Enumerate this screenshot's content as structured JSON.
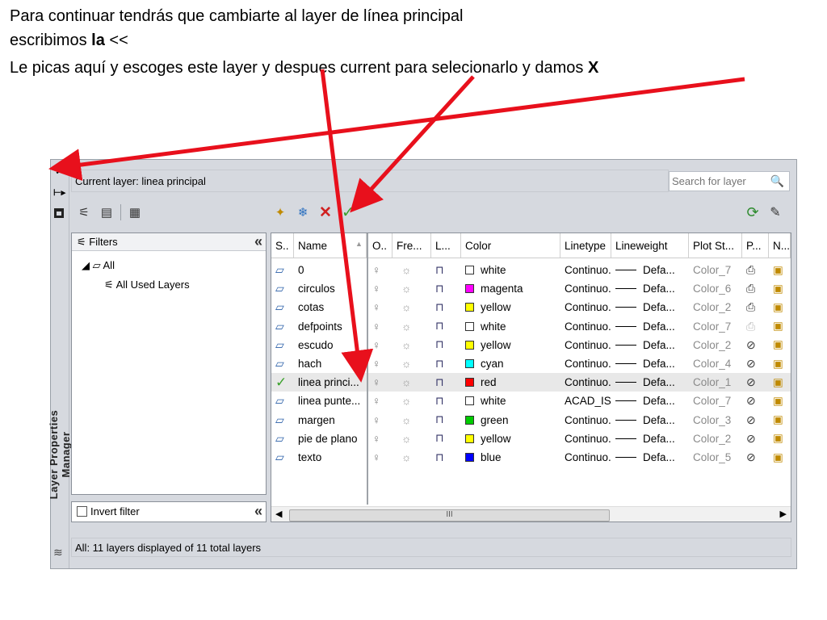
{
  "instructions": {
    "line1": "Para continuar tendrás que cambiarte al layer de línea principal",
    "line2_prefix": "escribimos ",
    "line2_bold": "la",
    "line2_suffix": " <<",
    "line3_prefix": "Le picas aquí y escoges este layer y despues current para selecionarlo y damos ",
    "line3_bold": "X"
  },
  "palette": {
    "arrow": "#e8101c",
    "window_bg": "#d6d9df",
    "selected_row": "#e8e8e8",
    "check": "#3aa12b",
    "delete_x": "#d02020"
  },
  "window": {
    "vertical_title": "Layer Properties Manager",
    "close_glyph": "✕",
    "current_layer": "Current layer: linea principal",
    "search_placeholder": "Search for layer",
    "filters_header": "Filters",
    "tree_all": "All",
    "tree_used": "All Used Layers",
    "invert_filter": "Invert filter",
    "scroll_thumb": "III",
    "status": "All: 11 layers displayed of 11 total layers"
  },
  "toolbar": {
    "left_icons": [
      "new-property-filter-icon",
      "new-group-filter-icon",
      "layer-states-manager-icon"
    ],
    "mid_icons": [
      "new-layer-icon",
      "new-layer-vp-frozen-icon",
      "delete-layer-icon",
      "set-current-icon"
    ],
    "right_icons": [
      "refresh-icon",
      "settings-icon"
    ]
  },
  "columns": [
    "S..",
    "Name",
    "O..",
    "Fre...",
    "L...",
    "Color",
    "Linetype",
    "Lineweight",
    "Plot St...",
    "P...",
    "N..."
  ],
  "layers": [
    {
      "name": "0",
      "color": "white",
      "hex": "#ffffff",
      "linetype": "Continuo...",
      "lineweight": "Defa...",
      "plot_style": "Color_7",
      "current": false,
      "plot": "printer"
    },
    {
      "name": "circulos",
      "color": "magenta",
      "hex": "#ff00ff",
      "linetype": "Continuo...",
      "lineweight": "Defa...",
      "plot_style": "Color_6",
      "current": false,
      "plot": "printer"
    },
    {
      "name": "cotas",
      "color": "yellow",
      "hex": "#ffff00",
      "linetype": "Continuo...",
      "lineweight": "Defa...",
      "plot_style": "Color_2",
      "current": false,
      "plot": "printer"
    },
    {
      "name": "defpoints",
      "color": "white",
      "hex": "#ffffff",
      "linetype": "Continuo...",
      "lineweight": "Defa...",
      "plot_style": "Color_7",
      "current": false,
      "plot": "printer-disabled"
    },
    {
      "name": "escudo",
      "color": "yellow",
      "hex": "#ffff00",
      "linetype": "Continuo...",
      "lineweight": "Defa...",
      "plot_style": "Color_2",
      "current": false,
      "plot": "no-plot"
    },
    {
      "name": "hach",
      "color": "cyan",
      "hex": "#00ffff",
      "linetype": "Continuo...",
      "lineweight": "Defa...",
      "plot_style": "Color_4",
      "current": false,
      "plot": "no-plot"
    },
    {
      "name": "linea princi...",
      "color": "red",
      "hex": "#ff0000",
      "linetype": "Continuo...",
      "lineweight": "Defa...",
      "plot_style": "Color_1",
      "current": true,
      "plot": "no-plot"
    },
    {
      "name": "linea punte...",
      "color": "white",
      "hex": "#ffffff",
      "linetype": "ACAD_IS...",
      "lineweight": "Defa...",
      "plot_style": "Color_7",
      "current": false,
      "plot": "no-plot"
    },
    {
      "name": "margen",
      "color": "green",
      "hex": "#00cc00",
      "linetype": "Continuo...",
      "lineweight": "Defa...",
      "plot_style": "Color_3",
      "current": false,
      "plot": "no-plot"
    },
    {
      "name": "pie de plano",
      "color": "yellow",
      "hex": "#ffff00",
      "linetype": "Continuo...",
      "lineweight": "Defa...",
      "plot_style": "Color_2",
      "current": false,
      "plot": "no-plot"
    },
    {
      "name": "texto",
      "color": "blue",
      "hex": "#0000ff",
      "linetype": "Continuo...",
      "lineweight": "Defa...",
      "plot_style": "Color_5",
      "current": false,
      "plot": "no-plot"
    }
  ]
}
